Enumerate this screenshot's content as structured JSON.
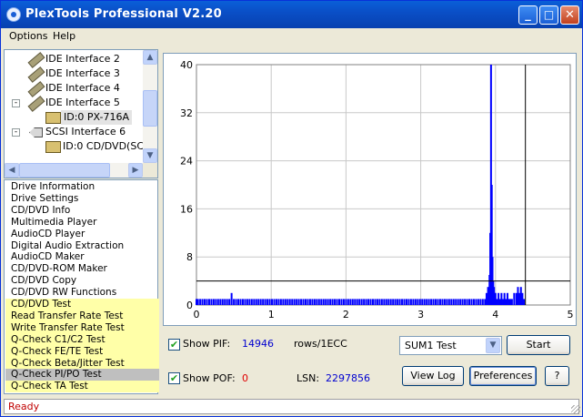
{
  "window": {
    "title": "PlexTools Professional V2.20"
  },
  "menu": {
    "options": "Options",
    "help": "Help"
  },
  "tree": {
    "items": [
      {
        "label": "IDE Interface 2"
      },
      {
        "label": "IDE Interface 3"
      },
      {
        "label": "IDE Interface 4"
      },
      {
        "label": "IDE Interface 5"
      },
      {
        "label": "ID:0  PX-716A"
      },
      {
        "label": "SCSI Interface 6"
      },
      {
        "label": "ID:0  CD/DVD(SC"
      }
    ]
  },
  "functions": {
    "items": [
      "Drive Information",
      "Drive Settings",
      "CD/DVD Info",
      "Multimedia Player",
      "AudioCD Player",
      "Digital Audio Extraction",
      "AudioCD Maker",
      "CD/DVD-ROM Maker",
      "CD/DVD Copy",
      "CD/DVD RW Functions",
      "CD/DVD Test",
      "Read Transfer Rate Test",
      "Write Transfer Rate Test",
      "Q-Check C1/C2 Test",
      "Q-Check FE/TE Test",
      "Q-Check Beta/Jitter Test",
      "Q-Check PI/PO Test",
      "Q-Check TA Test"
    ],
    "highlighted_from_index": 10,
    "selected_index": 16,
    "highlight_color": "#ffffa8",
    "selected_color": "#bfbfbf"
  },
  "chart_data": {
    "type": "bar",
    "x_ticks": [
      "0",
      "1",
      "2",
      "3",
      "4",
      "5"
    ],
    "y_ticks": [
      "0",
      "8",
      "16",
      "24",
      "32",
      "40"
    ],
    "xlim": [
      0,
      5
    ],
    "ylim": [
      0,
      40
    ],
    "reference_line_y": 4,
    "end_marker_x": 4.4,
    "bar_color": "#0000ff",
    "description_series": "PI errors (SUM1) per position, GB",
    "series": [
      {
        "values": [
          [
            0.0,
            1
          ],
          [
            0.02,
            1
          ],
          [
            0.05,
            1
          ],
          [
            0.08,
            1
          ],
          [
            0.11,
            1
          ],
          [
            0.14,
            1
          ],
          [
            0.17,
            1
          ],
          [
            0.2,
            1
          ],
          [
            0.23,
            1
          ],
          [
            0.26,
            1
          ],
          [
            0.29,
            1
          ],
          [
            0.32,
            1
          ],
          [
            0.35,
            1
          ],
          [
            0.38,
            1
          ],
          [
            0.41,
            1
          ],
          [
            0.44,
            1
          ],
          [
            0.47,
            2
          ],
          [
            0.5,
            1
          ],
          [
            0.53,
            1
          ],
          [
            0.56,
            1
          ],
          [
            0.59,
            1
          ],
          [
            0.62,
            1
          ],
          [
            0.65,
            1
          ],
          [
            0.68,
            1
          ],
          [
            0.71,
            1
          ],
          [
            0.74,
            1
          ],
          [
            0.77,
            1
          ],
          [
            0.8,
            1
          ],
          [
            0.83,
            1
          ],
          [
            0.86,
            1
          ],
          [
            0.89,
            1
          ],
          [
            0.92,
            1
          ],
          [
            0.95,
            1
          ],
          [
            0.98,
            1
          ],
          [
            1.01,
            1
          ],
          [
            1.04,
            1
          ],
          [
            1.07,
            1
          ],
          [
            1.1,
            1
          ],
          [
            1.13,
            1
          ],
          [
            1.16,
            1
          ],
          [
            1.19,
            1
          ],
          [
            1.22,
            1
          ],
          [
            1.25,
            1
          ],
          [
            1.28,
            1
          ],
          [
            1.31,
            1
          ],
          [
            1.34,
            1
          ],
          [
            1.37,
            1
          ],
          [
            1.4,
            1
          ],
          [
            1.43,
            1
          ],
          [
            1.46,
            1
          ],
          [
            1.49,
            1
          ],
          [
            1.52,
            1
          ],
          [
            1.55,
            1
          ],
          [
            1.58,
            1
          ],
          [
            1.61,
            1
          ],
          [
            1.64,
            1
          ],
          [
            1.67,
            1
          ],
          [
            1.7,
            1
          ],
          [
            1.73,
            1
          ],
          [
            1.76,
            1
          ],
          [
            1.79,
            1
          ],
          [
            1.82,
            1
          ],
          [
            1.85,
            1
          ],
          [
            1.88,
            1
          ],
          [
            1.91,
            1
          ],
          [
            1.94,
            1
          ],
          [
            1.97,
            1
          ],
          [
            2.0,
            1
          ],
          [
            2.03,
            1
          ],
          [
            2.06,
            1
          ],
          [
            2.09,
            1
          ],
          [
            2.12,
            1
          ],
          [
            2.15,
            1
          ],
          [
            2.18,
            1
          ],
          [
            2.21,
            1
          ],
          [
            2.24,
            1
          ],
          [
            2.27,
            1
          ],
          [
            2.3,
            1
          ],
          [
            2.33,
            1
          ],
          [
            2.36,
            1
          ],
          [
            2.39,
            1
          ],
          [
            2.42,
            1
          ],
          [
            2.45,
            1
          ],
          [
            2.48,
            1
          ],
          [
            2.51,
            1
          ],
          [
            2.54,
            1
          ],
          [
            2.57,
            1
          ],
          [
            2.6,
            1
          ],
          [
            2.63,
            1
          ],
          [
            2.66,
            1
          ],
          [
            2.69,
            1
          ],
          [
            2.72,
            1
          ],
          [
            2.75,
            1
          ],
          [
            2.78,
            1
          ],
          [
            2.81,
            1
          ],
          [
            2.84,
            1
          ],
          [
            2.87,
            1
          ],
          [
            2.9,
            1
          ],
          [
            2.93,
            1
          ],
          [
            2.96,
            1
          ],
          [
            2.99,
            1
          ],
          [
            3.02,
            1
          ],
          [
            3.05,
            1
          ],
          [
            3.08,
            1
          ],
          [
            3.11,
            1
          ],
          [
            3.14,
            1
          ],
          [
            3.17,
            1
          ],
          [
            3.2,
            1
          ],
          [
            3.23,
            1
          ],
          [
            3.26,
            1
          ],
          [
            3.29,
            1
          ],
          [
            3.32,
            1
          ],
          [
            3.35,
            1
          ],
          [
            3.38,
            1
          ],
          [
            3.41,
            1
          ],
          [
            3.44,
            1
          ],
          [
            3.47,
            1
          ],
          [
            3.5,
            1
          ],
          [
            3.53,
            1
          ],
          [
            3.56,
            1
          ],
          [
            3.59,
            1
          ],
          [
            3.62,
            1
          ],
          [
            3.65,
            1
          ],
          [
            3.68,
            1
          ],
          [
            3.71,
            1
          ],
          [
            3.74,
            1
          ],
          [
            3.77,
            1
          ],
          [
            3.8,
            1
          ],
          [
            3.83,
            1
          ],
          [
            3.86,
            1
          ],
          [
            3.88,
            2
          ],
          [
            3.9,
            3
          ],
          [
            3.92,
            5
          ],
          [
            3.93,
            12
          ],
          [
            3.94,
            40
          ],
          [
            3.95,
            20
          ],
          [
            3.96,
            8
          ],
          [
            3.97,
            4
          ],
          [
            3.98,
            3
          ],
          [
            3.99,
            2
          ],
          [
            4.0,
            2
          ],
          [
            4.02,
            1
          ],
          [
            4.04,
            2
          ],
          [
            4.06,
            1
          ],
          [
            4.08,
            2
          ],
          [
            4.1,
            1
          ],
          [
            4.12,
            2
          ],
          [
            4.14,
            1
          ],
          [
            4.16,
            2
          ],
          [
            4.18,
            1
          ],
          [
            4.2,
            1
          ],
          [
            4.22,
            1
          ],
          [
            4.25,
            2
          ],
          [
            4.28,
            2
          ],
          [
            4.3,
            3
          ],
          [
            4.32,
            2
          ],
          [
            4.34,
            3
          ],
          [
            4.36,
            2
          ],
          [
            4.38,
            1
          ]
        ]
      }
    ]
  },
  "controls": {
    "show_pif_label": "Show PIF:",
    "pif_value": "14946",
    "rows_label": "rows/1ECC",
    "test_select_value": "SUM1 Test",
    "start_label": "Start",
    "show_pof_label": "Show POF:",
    "pof_value": "0",
    "lsn_label": "LSN:",
    "lsn_value": "2297856",
    "view_log_label": "View Log",
    "preferences_label": "Preferences",
    "help_label": "?"
  },
  "status": {
    "text": "Ready",
    "color": "#c00000"
  }
}
